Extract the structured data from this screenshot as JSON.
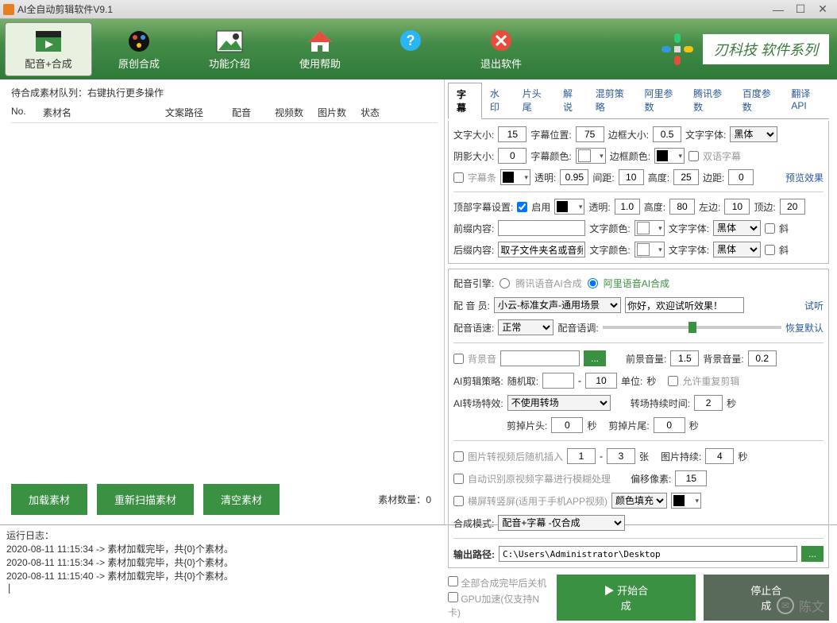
{
  "window": {
    "title": "AI全自动剪辑软件V9.1"
  },
  "toolbar": {
    "btn1": "配音+合成",
    "btn2": "原创合成",
    "btn3": "功能介绍",
    "btn4": "使用帮助",
    "btn5": "退出软件",
    "brand": "刃科技 软件系列"
  },
  "left": {
    "header": "待合成素材队列：右键执行更多操作",
    "cols": {
      "no": "No.",
      "name": "素材名",
      "path": "文案路径",
      "voice": "配音",
      "vidcount": "视频数",
      "imgcount": "图片数",
      "status": "状态"
    },
    "load": "加载素材",
    "rescan": "重新扫描素材",
    "clear": "清空素材",
    "countLabel": "素材数量：",
    "countVal": "0"
  },
  "tabs": {
    "t1": "字幕",
    "t2": "水印",
    "t3": "片头尾",
    "t4": "解说",
    "t5": "混剪策略",
    "t6": "阿里参数",
    "t7": "腾讯参数",
    "t8": "百度参数",
    "t9": "翻译API"
  },
  "sub": {
    "fontSizeL": "文字大小:",
    "fontSize": "15",
    "posL": "字幕位置:",
    "pos": "75",
    "borderL": "边框大小:",
    "border": "0.5",
    "fontL": "文字字体:",
    "font": "黑体",
    "shadowL": "阴影大小:",
    "shadow": "0",
    "colorL": "字幕颜色:",
    "borderColorL": "边框颜色:",
    "bilingual": "双语字幕",
    "bgbar": "字幕条",
    "opacityL": "透明:",
    "opacity": "0.95",
    "gapL": "间距:",
    "gap": "10",
    "heightL": "高度:",
    "height": "25",
    "marginL": "边距:",
    "margin": "0",
    "preview": "预览效果",
    "topL": "顶部字幕设置:",
    "enable": "启用",
    "topOpacity": "1.0",
    "topHeight": "80",
    "topLeft": "10",
    "topTop": "20",
    "topLeftL": "左边:",
    "topTopL": "顶边:",
    "prefixL": "前缀内容:",
    "textColorL": "文字颜色:",
    "textFontL": "文字字体:",
    "italic": "斜",
    "suffixL": "后缀内容:",
    "suffix": "取子文件夹名或音频"
  },
  "voice": {
    "engineL": "配音引擎:",
    "tencent": "腾讯语音AI合成",
    "ali": "阿里语音AI合成",
    "actorL": "配 音 员:",
    "actor": "小云-标准女声-通用场景",
    "sample": "你好，欢迎试听效果！",
    "test": "试听",
    "speedL": "配音语速:",
    "speed": "正常",
    "pitchL": "配音语调:",
    "reset": "恢复默认",
    "bgm": "背景音",
    "fgVolL": "前景音量:",
    "fgVol": "1.5",
    "bgVolL": "背景音量:",
    "bgVol": "0.2",
    "stratL": "AI剪辑策略:",
    "strat": "随机取:",
    "stratTo": "10",
    "unitL": "单位:",
    "unit": "秒",
    "dup": "允许重复剪辑",
    "transL": "AI转场特效:",
    "trans": "不使用转场",
    "transDurL": "转场持续时间:",
    "transDur": "2",
    "sec": "秒",
    "cutHeadL": "剪掉片头:",
    "cutHead": "0",
    "cutTailL": "剪掉片尾:",
    "cutTail": "0",
    "imgInsert": "图片转视频后随机插入",
    "imgFrom": "1",
    "imgTo": "3",
    "zhang": "张",
    "imgDurL": "图片持续:",
    "imgDur": "4",
    "autoBlur": "自动识别原视频字幕进行模糊处理",
    "offsetL": "偏移像素:",
    "offset": "15",
    "rotate": "横屏转竖屏(适用于手机APP视频)",
    "fill": "颜色填充",
    "modeL": "合成模式:",
    "mode": "配音+字幕 -仅合成",
    "outL": "输出路径:",
    "out": "C:\\Users\\Administrator\\Desktop",
    "shutdown": "全部合成完毕后关机",
    "gpu": "GPU加速(仅支持N卡)",
    "start": "开始合成",
    "stop": "停止合成"
  },
  "log": {
    "title": "运行日志：",
    "l1": "2020-08-11 11:15:34 -> 素材加载完毕，共{0}个素材。",
    "l2": "2020-08-11 11:15:34 -> 素材加载完毕，共{0}个素材。",
    "l3": "2020-08-11 11:15:40 -> 素材加载完毕，共{0}个素材。"
  },
  "wm": "陈文"
}
